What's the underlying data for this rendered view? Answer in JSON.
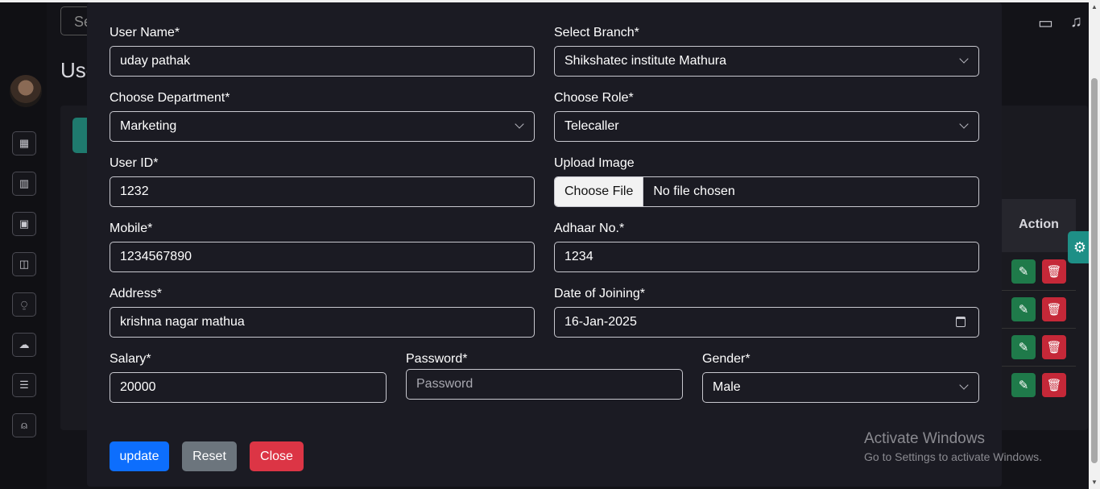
{
  "background": {
    "search_stub": "Se",
    "title_stub": "Use",
    "table_action_header": "Action",
    "row_count": 4
  },
  "form": {
    "user_name": {
      "label": "User Name*",
      "value": "uday pathak"
    },
    "branch": {
      "label": "Select Branch*",
      "value": "Shikshatec institute Mathura"
    },
    "department": {
      "label": "Choose Department*",
      "value": "Marketing"
    },
    "role": {
      "label": "Choose Role*",
      "value": "Telecaller"
    },
    "user_id": {
      "label": "User ID*",
      "value": "1232"
    },
    "upload_image": {
      "label": "Upload Image",
      "button": "Choose File",
      "status": "No file chosen"
    },
    "mobile": {
      "label": "Mobile*",
      "value": "1234567890"
    },
    "adhaar": {
      "label": "Adhaar No.*",
      "value": "1234"
    },
    "address": {
      "label": "Address*",
      "value": "krishna nagar mathua"
    },
    "date_of_joining": {
      "label": "Date of Joining*",
      "value": "16-Jan-2025"
    },
    "salary": {
      "label": "Salary*",
      "value": "20000"
    },
    "password": {
      "label": "Password*",
      "placeholder": "Password"
    },
    "gender": {
      "label": "Gender*",
      "value": "Male"
    }
  },
  "buttons": {
    "update": "update",
    "reset": "Reset",
    "close": "Close"
  },
  "colors": {
    "update": "#0d6efd",
    "reset": "#6c757d",
    "close": "#dc3545"
  },
  "watermark": {
    "line1": "Activate Windows",
    "line2": "Go to Settings to activate Windows."
  }
}
